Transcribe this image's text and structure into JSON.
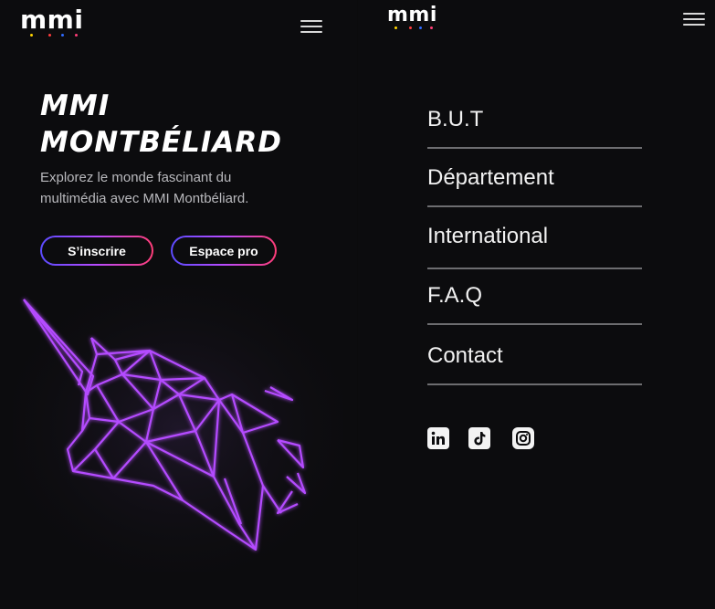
{
  "left_screen": {
    "logo": {
      "text": "mmi",
      "dot_colors": [
        "#ffd400",
        "#ff3d3d",
        "#2f6bff",
        "#ff3d77"
      ]
    },
    "menu_icon": "hamburger-menu-icon",
    "hero": {
      "title_line1": "MMI",
      "title_line2": "MONTBÉLIARD",
      "subtitle_line1": "Explorez le monde fascinant du",
      "subtitle_line2": "multimédia avec MMI Montbéliard."
    },
    "buttons": {
      "signup": "S’inscrire",
      "pro": "Espace pro"
    },
    "illustration": "neon-unicorn-head-illustration"
  },
  "right_screen": {
    "logo": {
      "text": "mmi",
      "dot_colors": [
        "#ffd400",
        "#ff3d3d",
        "#2f6bff",
        "#ff3d77"
      ]
    },
    "menu_icon": "hamburger-menu-icon",
    "nav": [
      {
        "label": "B.U.T"
      },
      {
        "label": "Département"
      },
      {
        "label": "International"
      },
      {
        "label": "F.A.Q"
      },
      {
        "label": "Contact"
      }
    ],
    "socials": [
      {
        "name": "linkedin-icon"
      },
      {
        "name": "tiktok-icon"
      },
      {
        "name": "instagram-icon"
      }
    ]
  },
  "colors": {
    "background": "#0c0c0e",
    "button_gradient": [
      "#5b4bff",
      "#b84bff",
      "#ff3d77"
    ],
    "neon": "#b44bff",
    "nav_divider": "#6d6d70"
  }
}
